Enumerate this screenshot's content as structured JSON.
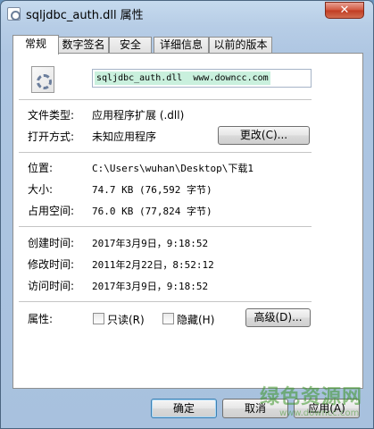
{
  "window": {
    "title": "sqljdbc_auth.dll 属性",
    "close_label": "✕"
  },
  "tabs": [
    {
      "label": "常规",
      "active": true
    },
    {
      "label": "数字签名",
      "active": false
    },
    {
      "label": "安全",
      "active": false
    },
    {
      "label": "详细信息",
      "active": false
    },
    {
      "label": "以前的版本",
      "active": false
    }
  ],
  "general": {
    "filename": "sqljdbc_auth.dll  www.downcc.com",
    "file_type_label": "文件类型:",
    "file_type_value": "应用程序扩展 (.dll)",
    "opens_with_label": "打开方式:",
    "opens_with_value": "未知应用程序",
    "change_button": "更改(C)...",
    "location_label": "位置:",
    "location_value": "C:\\Users\\wuhan\\Desktop\\下载1",
    "size_label": "大小:",
    "size_value": "74.7 KB (76,592 字节)",
    "size_on_disk_label": "占用空间:",
    "size_on_disk_value": "76.0 KB (77,824 字节)",
    "created_label": "创建时间:",
    "created_value": "2017年3月9日，9:18:52",
    "modified_label": "修改时间:",
    "modified_value": "2011年2月22日，8:52:12",
    "accessed_label": "访问时间:",
    "accessed_value": "2017年3月9日，9:18:52",
    "attributes_label": "属性:",
    "readonly_label": "只读(R)",
    "hidden_label": "隐藏(H)",
    "advanced_button": "高级(D)..."
  },
  "footer": {
    "ok": "确定",
    "cancel": "取消",
    "apply": "应用(A)"
  },
  "watermark": {
    "line1": "绿色资源网",
    "line2": "www.downcc.com"
  }
}
